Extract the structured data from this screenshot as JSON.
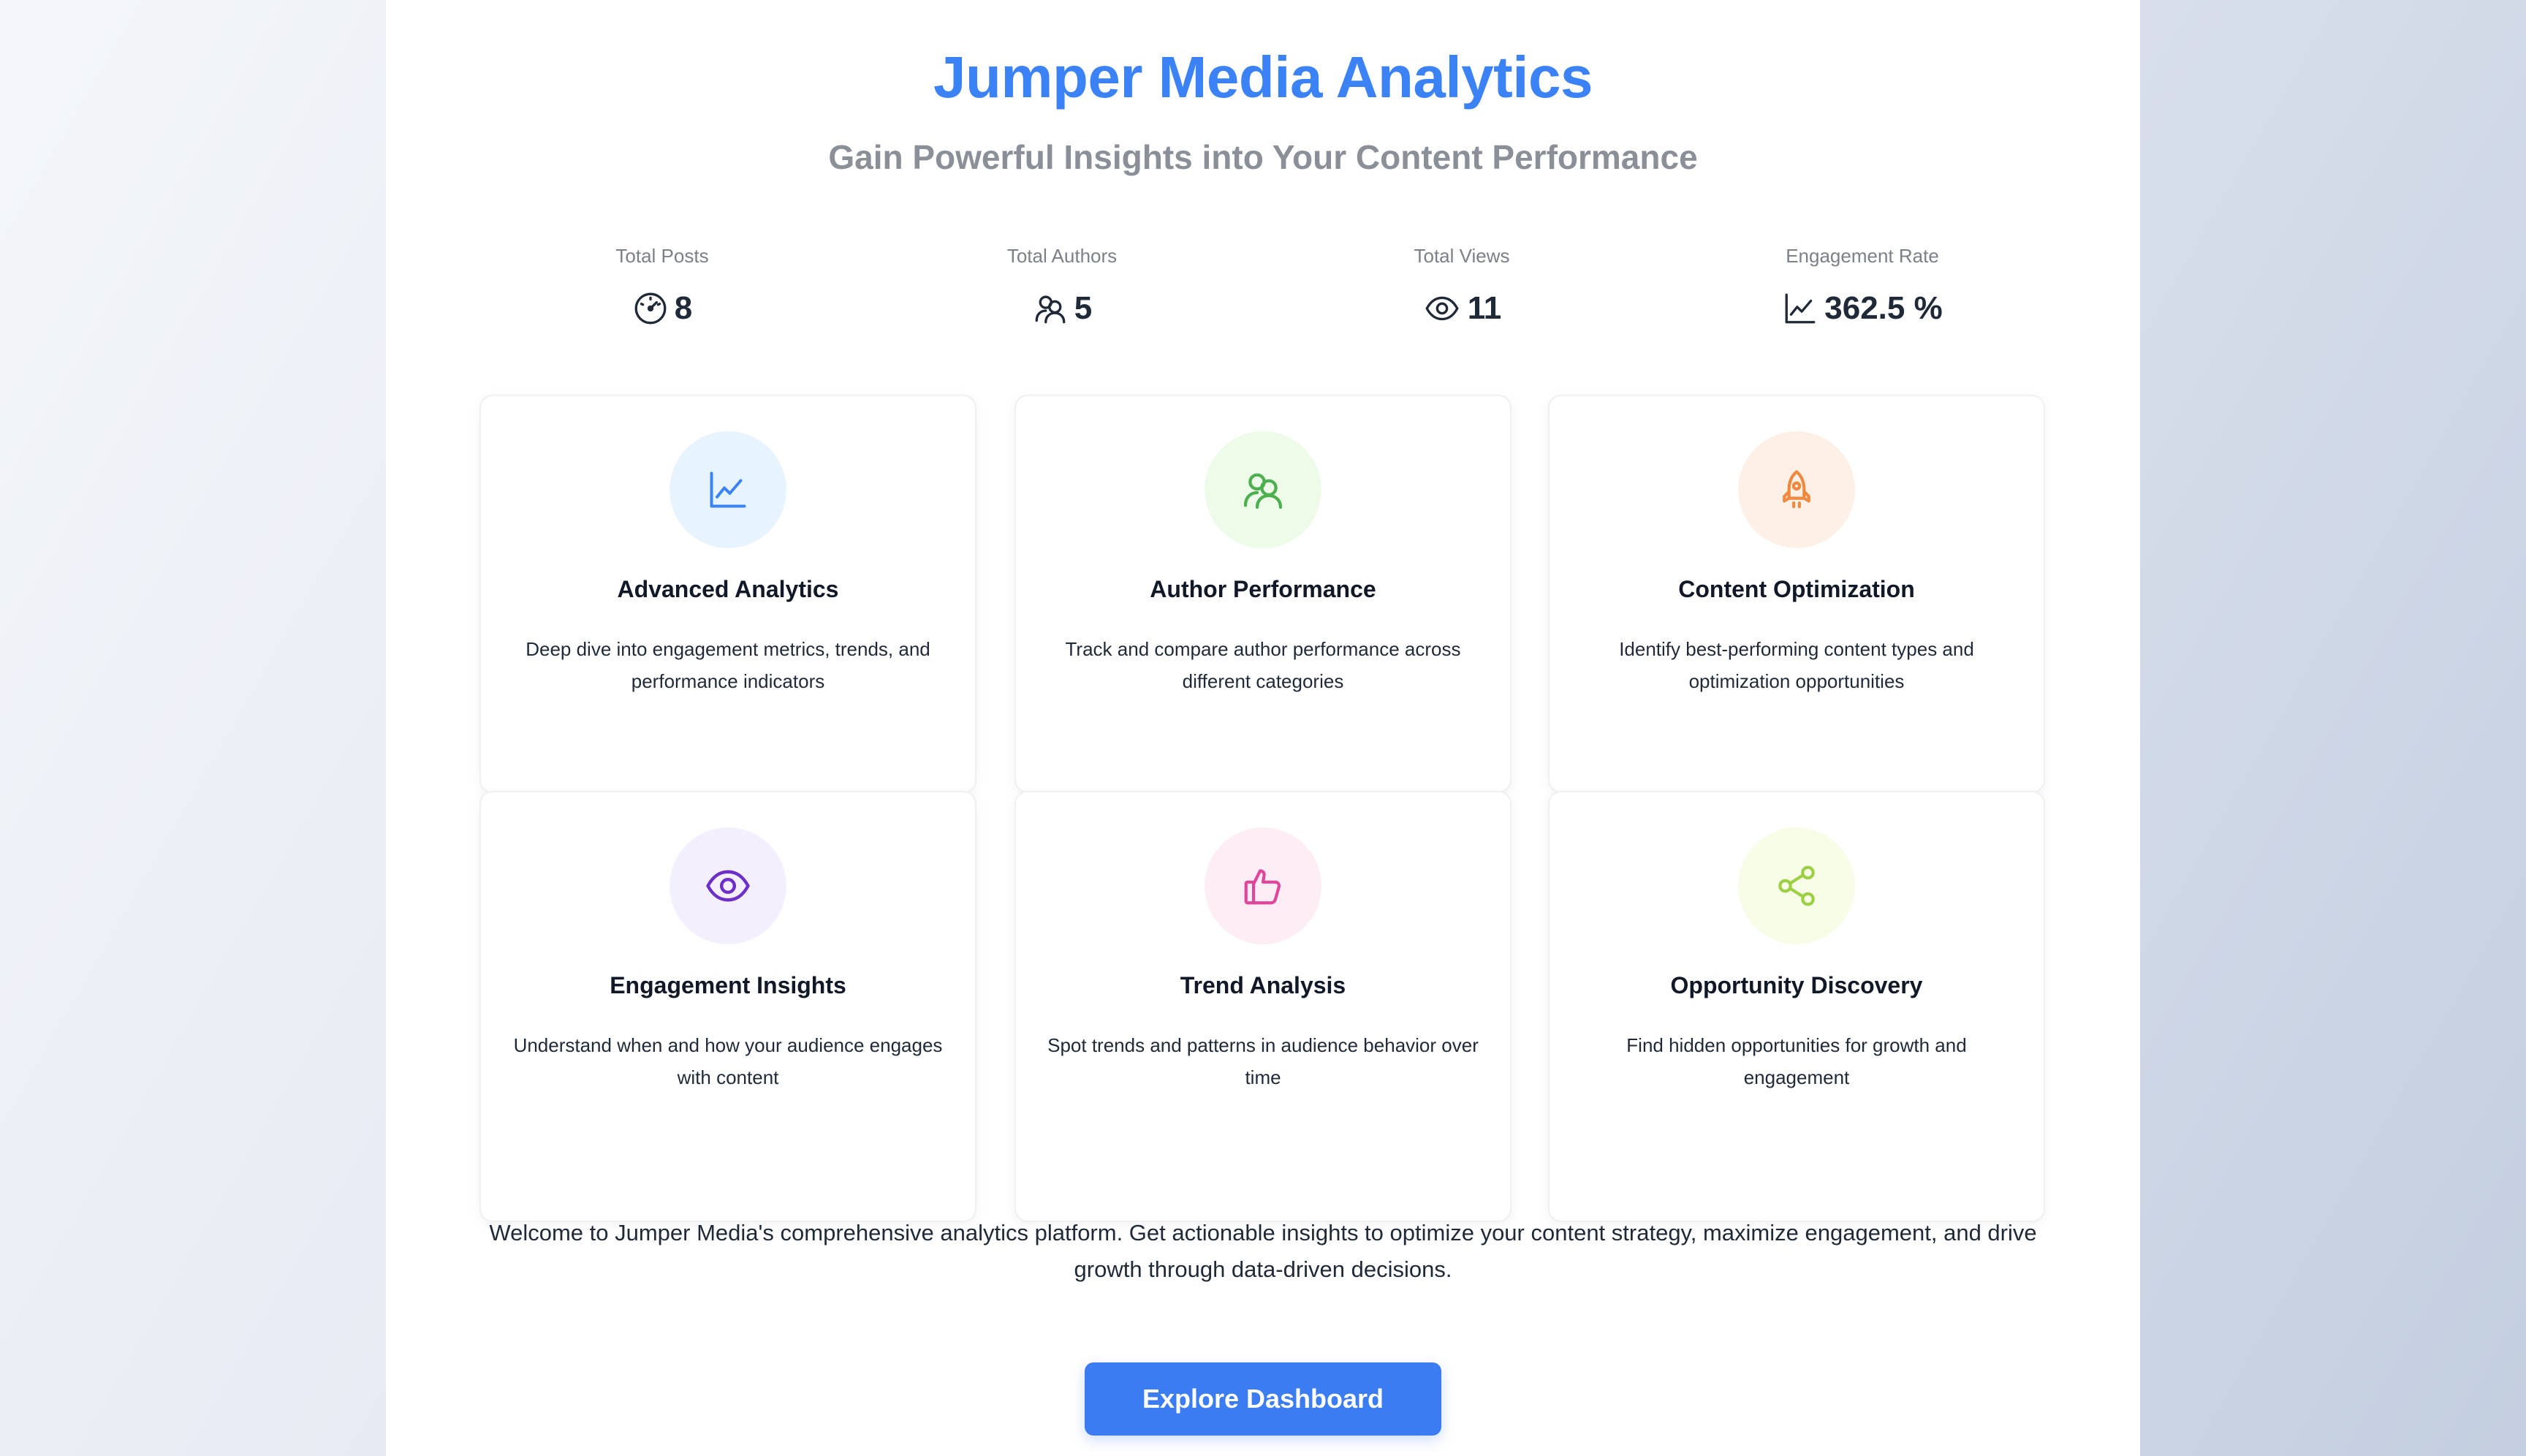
{
  "header": {
    "title": "Jumper Media Analytics",
    "subtitle": "Gain Powerful Insights into Your Content Performance"
  },
  "stats": [
    {
      "label": "Total Posts",
      "value": "8",
      "icon": "gauge-icon"
    },
    {
      "label": "Total Authors",
      "value": "5",
      "icon": "users-icon"
    },
    {
      "label": "Total Views",
      "value": "11",
      "icon": "eye-icon"
    },
    {
      "label": "Engagement Rate",
      "value": "362.5 %",
      "icon": "chart-line-icon"
    }
  ],
  "features": [
    {
      "title": "Advanced Analytics",
      "description": "Deep dive into engagement metrics, trends, and performance indicators",
      "icon": "chart-line-icon",
      "color": "#3b82f6",
      "bg": "#e8f4fd"
    },
    {
      "title": "Author Performance",
      "description": "Track and compare author performance across different categories",
      "icon": "users-icon",
      "color": "#4caf50",
      "bg": "#eefbe8"
    },
    {
      "title": "Content Optimization",
      "description": "Identify best-performing content types and optimization opportunities",
      "icon": "rocket-icon",
      "color": "#f0883e",
      "bg": "#fdf1e7"
    },
    {
      "title": "Engagement Insights",
      "description": "Understand when and how your audience engages with content",
      "icon": "eye-icon",
      "color": "#6d2fc9",
      "bg": "#f4effd"
    },
    {
      "title": "Trend Analysis",
      "description": "Spot trends and patterns in audience behavior over time",
      "icon": "thumbs-up-icon",
      "color": "#e0449b",
      "bg": "#fdedf4"
    },
    {
      "title": "Opportunity Discovery",
      "description": "Find hidden opportunities for growth and engagement",
      "icon": "share-icon",
      "color": "#9bd043",
      "bg": "#f7fde7"
    }
  ],
  "intro": "Welcome to Jumper Media's comprehensive analytics platform. Get actionable insights to optimize your content strategy, maximize engagement, and drive growth through data-driven decisions.",
  "cta": {
    "label": "Explore Dashboard"
  }
}
